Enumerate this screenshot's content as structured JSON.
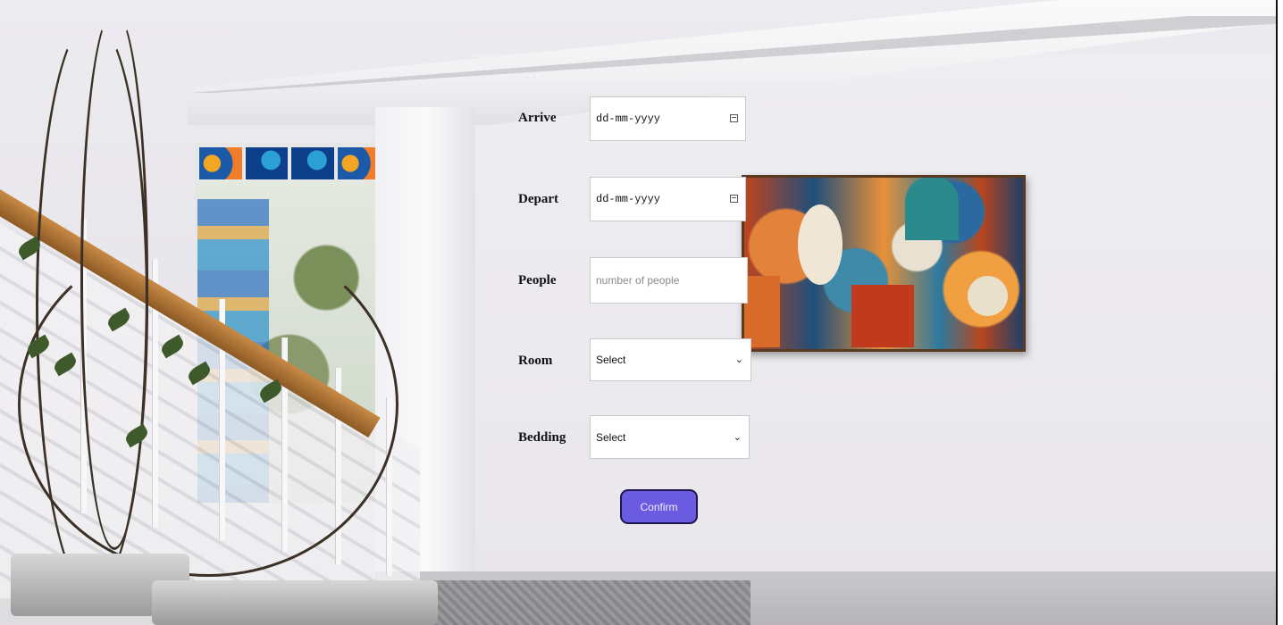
{
  "booking_form": {
    "fields": [
      {
        "label": "Arrive",
        "type": "date",
        "value": "dd-mm-yyyy",
        "icon": "calendar-icon"
      },
      {
        "label": "Depart",
        "type": "date",
        "value": "dd-mm-yyyy",
        "icon": "calendar-icon"
      },
      {
        "label": "People",
        "type": "number",
        "placeholder": "number of people"
      },
      {
        "label": "Room",
        "type": "select",
        "value": "Select",
        "icon": "chevron-down-icon"
      },
      {
        "label": "Bedding",
        "type": "select",
        "value": "Select",
        "icon": "chevron-down-icon"
      }
    ],
    "confirm_label": "Confirm"
  },
  "colors": {
    "confirm_button": "#6a5be0",
    "confirm_border": "#1d1648",
    "rail_wood": "#a86d33",
    "painting_frame": "#5a3b20"
  }
}
